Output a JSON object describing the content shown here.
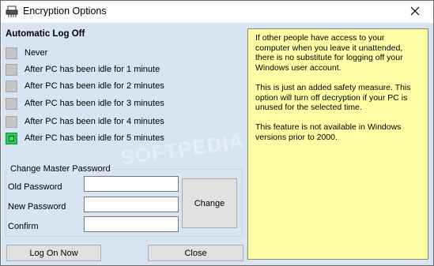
{
  "window": {
    "title": "Encryption Options",
    "app_icon": "shredder-icon",
    "close_icon": "close-icon"
  },
  "auto_logoff": {
    "title": "Automatic Log Off",
    "options": [
      {
        "label": "Never",
        "selected": false
      },
      {
        "label": "After PC has been idle for 1 minute",
        "selected": false
      },
      {
        "label": "After PC has been idle for 2 minutes",
        "selected": false
      },
      {
        "label": "After PC has been idle for 3 minutes",
        "selected": false
      },
      {
        "label": "After PC has been idle for 4 minutes",
        "selected": false
      },
      {
        "label": "After PC has been idle for 5 minutes",
        "selected": true
      }
    ]
  },
  "password": {
    "group_title": "Change Master Password",
    "old_label": "Old Password",
    "new_label": "New Password",
    "confirm_label": "Confirm",
    "old_value": "",
    "new_value": "",
    "confirm_value": "",
    "change_button": "Change"
  },
  "buttons": {
    "log_on_now": "Log On Now",
    "close": "Close"
  },
  "info": {
    "p1": "If other people have access to your computer when you leave it unattended, there is no substitute for logging off your Windows user account.",
    "p2": "This is just an added safety measure. This option will turn off decryption if your PC is unused for the selected time.",
    "p3": "This feature is not available in Windows versions prior to 2000."
  },
  "watermark": "SOFTPEDIA",
  "colors": {
    "client_bg": "#d7e4f2",
    "info_bg": "#ffffa6",
    "selected_radio": "#22c955",
    "unselected_radio": "#c4c4c4"
  }
}
